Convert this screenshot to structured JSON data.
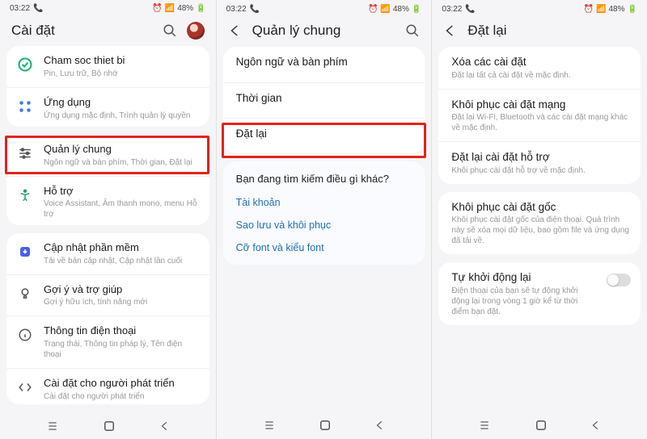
{
  "status": {
    "time": "03:22",
    "battery": "48%"
  },
  "screen1": {
    "title": "Cài đặt",
    "items": {
      "care": {
        "t": "Cham soc thiet bi",
        "s": "Pin, Lưu trữ, Bộ nhớ"
      },
      "apps": {
        "t": "Ứng dụng",
        "s": "Ứng dụng mặc định, Trình quản lý quyền"
      },
      "general": {
        "t": "Quản lý chung",
        "s": "Ngôn ngữ và bàn phím, Thời gian, Đặt lại"
      },
      "access": {
        "t": "Hỗ trợ",
        "s": "Voice Assistant, Âm thanh mono, menu Hỗ trợ"
      },
      "update": {
        "t": "Cập nhật phần mềm",
        "s": "Tải về bản cập nhật, Cập nhật lần cuối"
      },
      "tips": {
        "t": "Gợi ý và trợ giúp",
        "s": "Gợi ý hữu ích, tính năng mới"
      },
      "about": {
        "t": "Thông tin điện thoại",
        "s": "Trạng thái, Thông tin pháp lý, Tên điện thoại"
      },
      "dev": {
        "t": "Cài đặt cho người phát triển",
        "s": "Cài đặt cho người phát triển"
      }
    }
  },
  "screen2": {
    "title": "Quản lý chung",
    "items": {
      "lang": "Ngôn ngữ và bàn phím",
      "time": "Thời gian",
      "reset": "Đặt lại"
    },
    "more_head": "Bạn đang tìm kiếm điều gì khác?",
    "links": {
      "accounts": "Tài khoản",
      "backup": "Sao lưu và khôi phục",
      "font": "Cỡ font và kiểu font"
    }
  },
  "screen3": {
    "title": "Đặt lại",
    "items": {
      "delset": {
        "t": "Xóa các cài đặt",
        "s": "Đặt lại tất cả cài đặt về mặc định."
      },
      "netreset": {
        "t": "Khôi phục cài đặt mạng",
        "s": "Đặt lại Wi-Fi, Bluetooth và các cài đặt mạng khác về mặc định."
      },
      "accreset": {
        "t": "Đặt lại cài đặt hỗ trợ",
        "s": "Khôi phục cài đặt hỗ trợ về mặc định."
      },
      "factory": {
        "t": "Khôi phục cài đặt gốc",
        "s": "Khôi phục cài đặt gốc của điện thoại. Quá trình này sẽ xóa mọi dữ liệu, bao gồm file và ứng dụng đã tải về."
      },
      "auto": {
        "t": "Tự khởi động lại",
        "s": "Điện thoại của bạn sẽ tự động khởi động lại trong vòng 1 giờ kể từ thời điểm bạn đặt."
      }
    }
  }
}
